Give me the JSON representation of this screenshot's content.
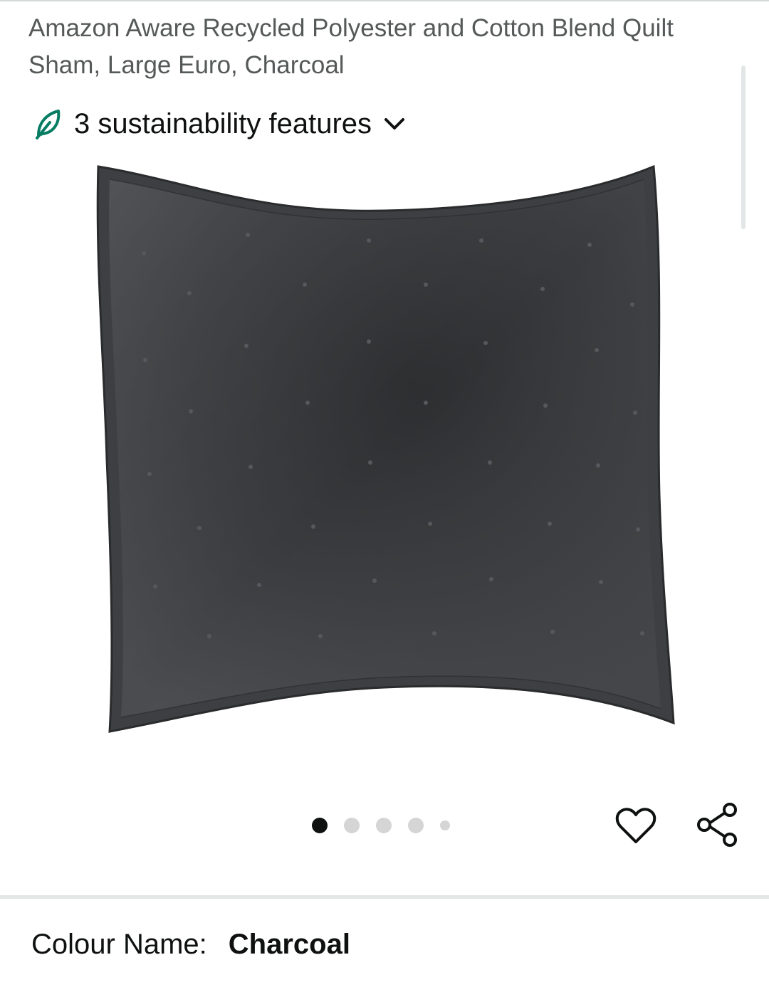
{
  "product": {
    "title": "Amazon Aware Recycled Polyester and Cotton Blend Quilt Sham, Large Euro, Charcoal"
  },
  "sustainability": {
    "label": "3 sustainability features",
    "icon": "leaf-icon",
    "accent_color": "#067d62"
  },
  "gallery": {
    "image_subject": "charcoal quilted sham",
    "image_count": 5,
    "active_index": 0,
    "wishlist_icon": "heart-outline-icon",
    "share_icon": "share-icon"
  },
  "variation": {
    "label": "Colour Name:",
    "value": "Charcoal"
  }
}
